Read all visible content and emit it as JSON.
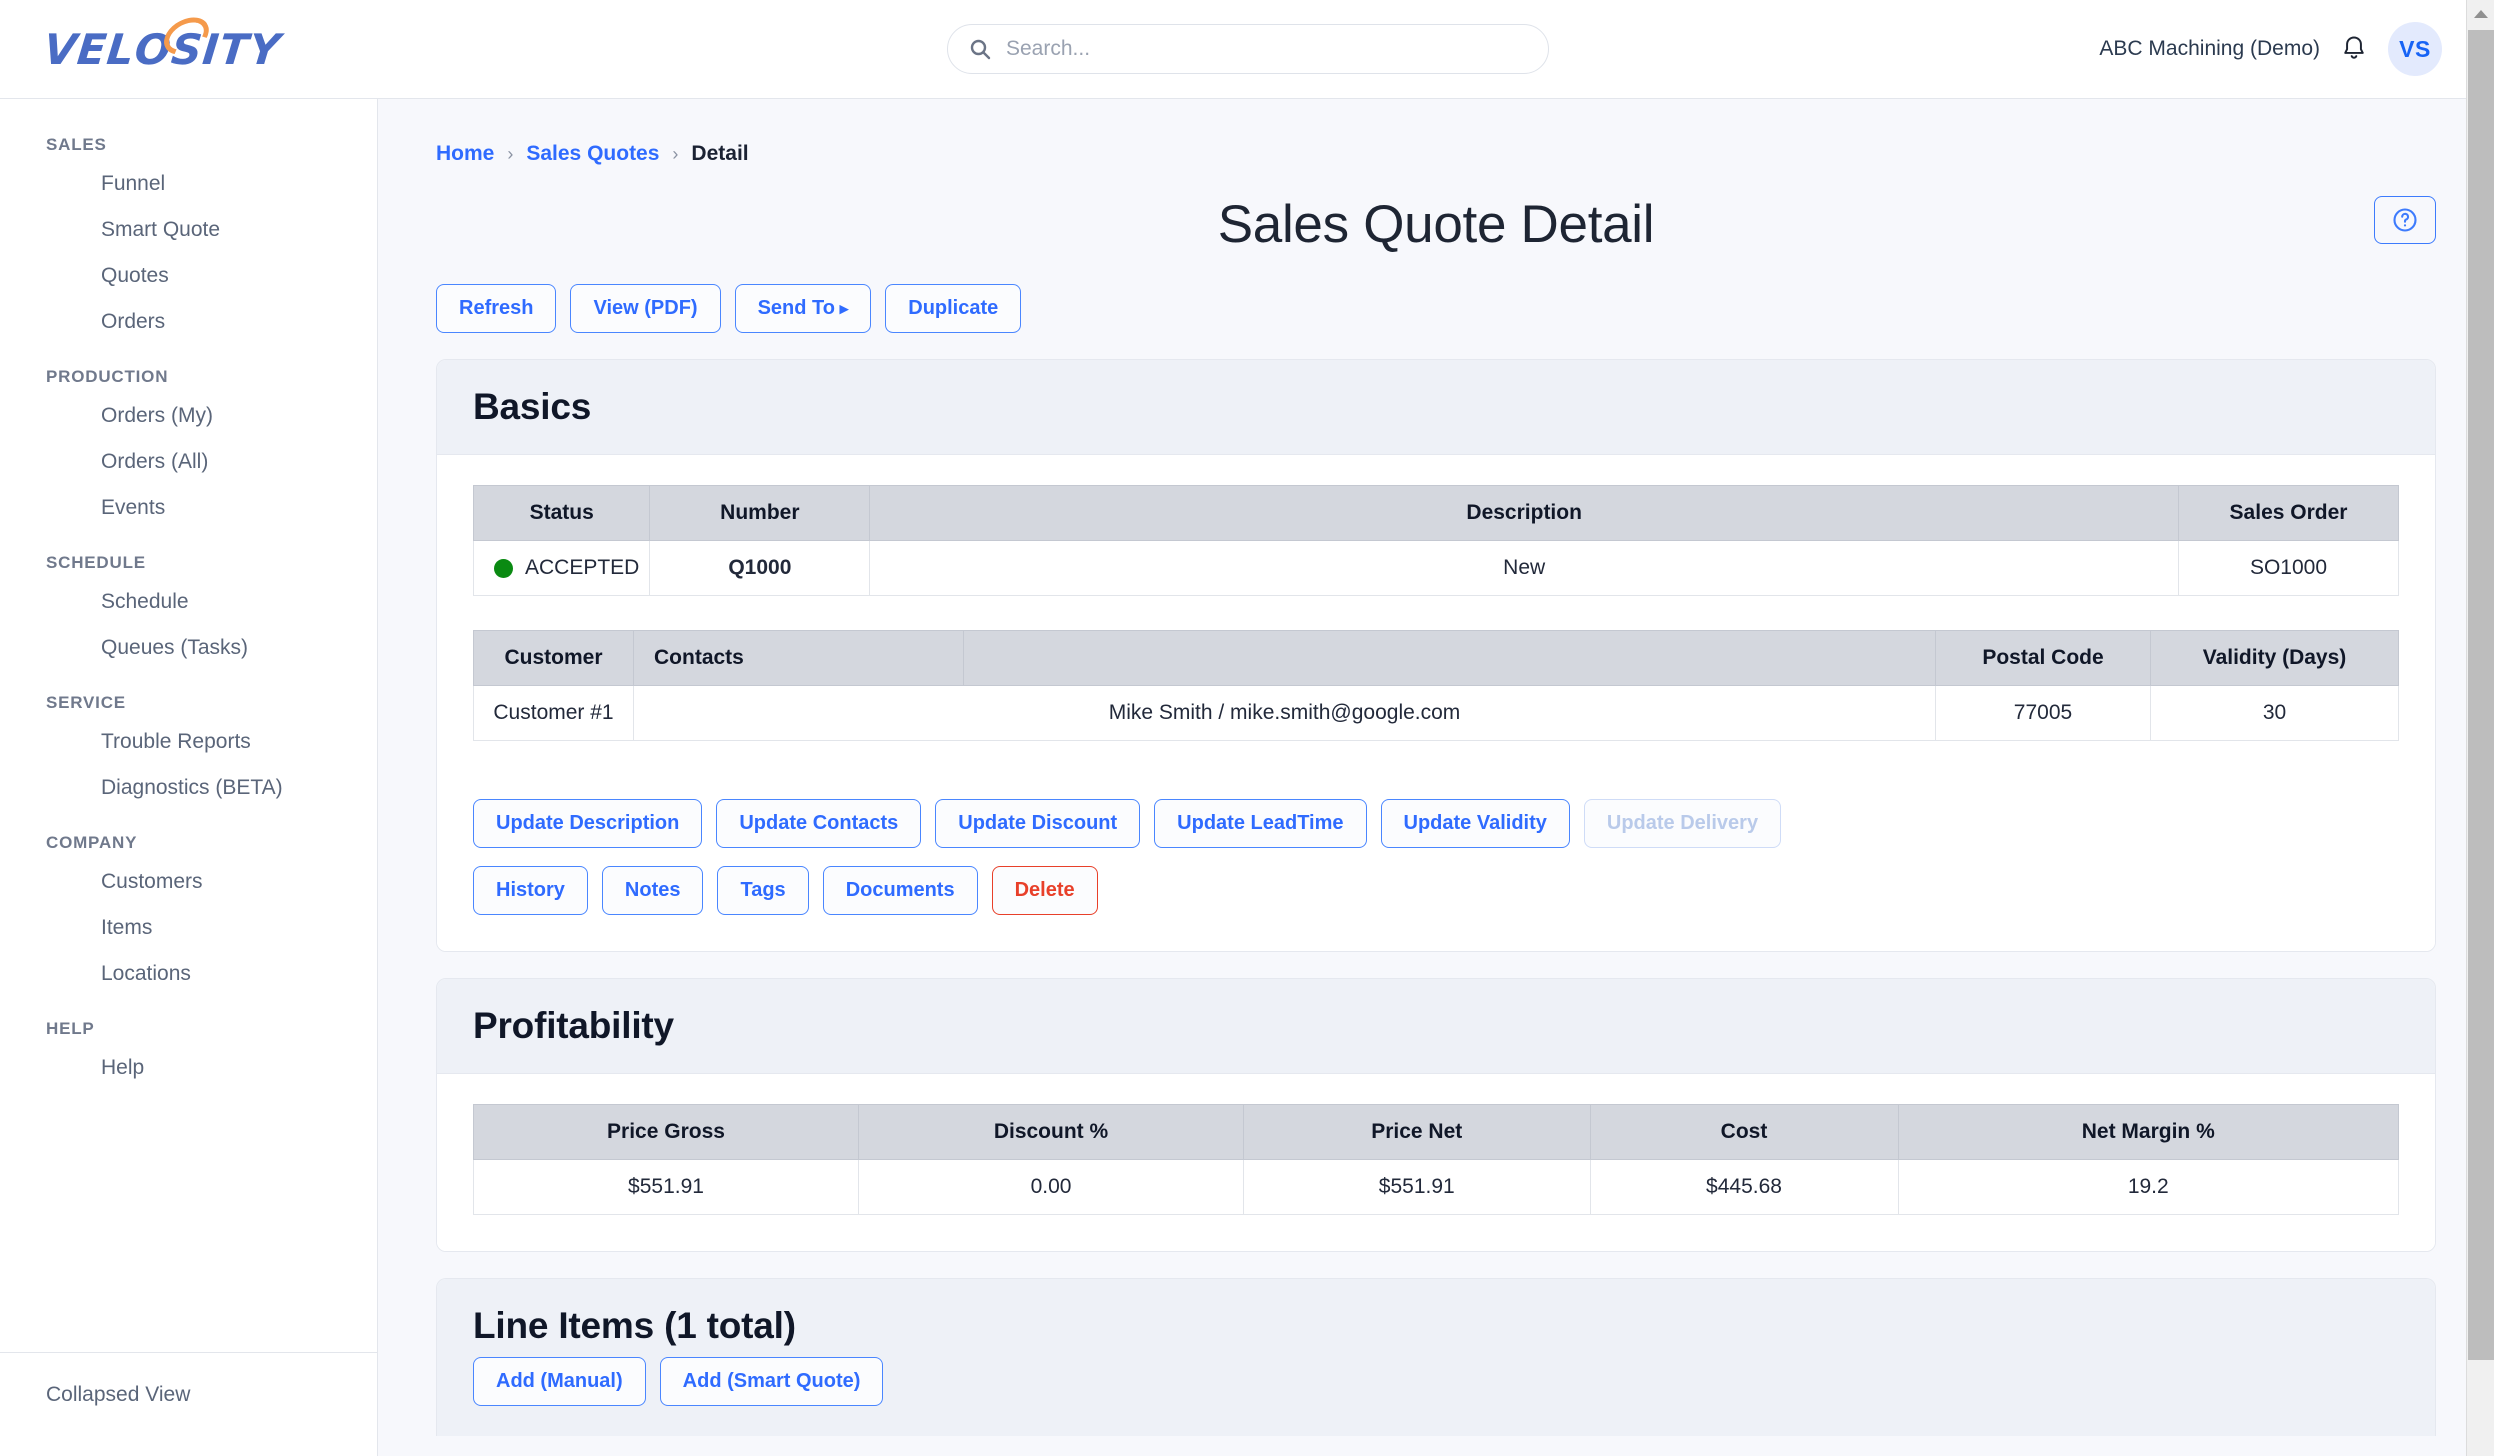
{
  "brand": {
    "name": "VELOSITY",
    "prefix": "VEL",
    "mid": "O",
    "suffix": "SITY",
    "color": "#4a6cc4",
    "accent": "#f59a4b"
  },
  "header": {
    "search_placeholder": "Search...",
    "search_value": "",
    "org": "ABC Machining (Demo)",
    "avatar_initials": "VS",
    "bell_icon": "bell-icon",
    "search_icon": "search-icon"
  },
  "sidebar": {
    "groups": [
      {
        "title": "SALES",
        "items": [
          "Funnel",
          "Smart Quote",
          "Quotes",
          "Orders"
        ]
      },
      {
        "title": "PRODUCTION",
        "items": [
          "Orders (My)",
          "Orders (All)",
          "Events"
        ]
      },
      {
        "title": "SCHEDULE",
        "items": [
          "Schedule",
          "Queues (Tasks)"
        ]
      },
      {
        "title": "SERVICE",
        "items": [
          "Trouble Reports",
          "Diagnostics (BETA)"
        ]
      },
      {
        "title": "COMPANY",
        "items": [
          "Customers",
          "Items",
          "Locations"
        ]
      },
      {
        "title": "HELP",
        "items": [
          "Help"
        ]
      }
    ],
    "footer": "Collapsed View"
  },
  "breadcrumb": {
    "home": "Home",
    "parent": "Sales Quotes",
    "current": "Detail",
    "separator": "›"
  },
  "page": {
    "title": "Sales Quote Detail",
    "help_icon": "question-mark-circle-icon"
  },
  "toolbar": {
    "refresh": "Refresh",
    "view_pdf": "View (PDF)",
    "send_to": "Send To",
    "duplicate": "Duplicate"
  },
  "basics": {
    "heading": "Basics",
    "table1": {
      "headers": [
        "Status",
        "Number",
        "Description",
        "Sales Order"
      ],
      "row": {
        "status": "ACCEPTED",
        "status_color": "#0a8a12",
        "number": "Q1000",
        "number_color": "#e80000",
        "description": "New",
        "sales_order": "SO1000"
      }
    },
    "table2": {
      "headers": [
        "Customer",
        "Contacts",
        "",
        "Postal Code",
        "Validity (Days)"
      ],
      "row": {
        "customer": "Customer #1",
        "contacts": "Mike Smith / mike.smith@google.com",
        "blank": "",
        "postal_code": "77005",
        "validity_days": "30"
      }
    },
    "actions_row1": [
      {
        "label": "Update Description",
        "disabled": false
      },
      {
        "label": "Update Contacts",
        "disabled": false
      },
      {
        "label": "Update Discount",
        "disabled": false
      },
      {
        "label": "Update LeadTime",
        "disabled": false
      },
      {
        "label": "Update Validity",
        "disabled": false
      },
      {
        "label": "Update Delivery",
        "disabled": true
      }
    ],
    "actions_row2": [
      {
        "label": "History",
        "danger": false
      },
      {
        "label": "Notes",
        "danger": false
      },
      {
        "label": "Tags",
        "danger": false
      },
      {
        "label": "Documents",
        "danger": false
      },
      {
        "label": "Delete",
        "danger": true
      }
    ]
  },
  "profitability": {
    "heading": "Profitability",
    "headers": [
      "Price Gross",
      "Discount %",
      "Price Net",
      "Cost",
      "Net Margin %"
    ],
    "row": {
      "price_gross": "$551.91",
      "discount_pct": "0.00",
      "price_net": "$551.91",
      "cost": "$445.68",
      "net_margin_pct": "19.2"
    }
  },
  "line_items": {
    "heading": "Line Items (1 total)",
    "add_manual": "Add (Manual)",
    "add_smart_quote": "Add (Smart Quote)"
  }
}
